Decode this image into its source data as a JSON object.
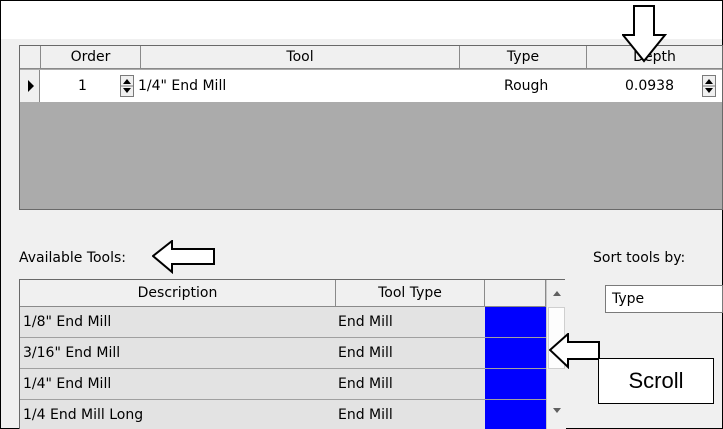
{
  "upper_grid": {
    "headers": {
      "order": "Order",
      "tool": "Tool",
      "type": "Type",
      "depth": "Depth"
    },
    "row": {
      "order": "1",
      "tool": "1/4\" End Mill",
      "type": "Rough",
      "depth": "0.0938"
    }
  },
  "available_tools_label": "Available Tools:",
  "sort_label": "Sort tools by:",
  "sort_value": "Type",
  "lower_grid": {
    "headers": {
      "description": "Description",
      "tool_type": "Tool Type"
    },
    "rows": [
      {
        "description": "1/8\" End Mill",
        "tool_type": "End Mill",
        "color": "#0000ff"
      },
      {
        "description": "3/16\" End Mill",
        "tool_type": "End Mill",
        "color": "#0000ff"
      },
      {
        "description": "1/4\" End Mill",
        "tool_type": "End Mill",
        "color": "#0000ff"
      },
      {
        "description": "1/4 End Mill Long",
        "tool_type": "End Mill",
        "color": "#0000ff"
      }
    ]
  },
  "callout_text": "Scroll",
  "icons": [
    "row-pointer-icon",
    "spinner-icon",
    "scroll-up-arrow-icon",
    "scroll-down-arrow-icon",
    "down-arrow-annotation-icon",
    "left-arrow-annotation-icon"
  ]
}
